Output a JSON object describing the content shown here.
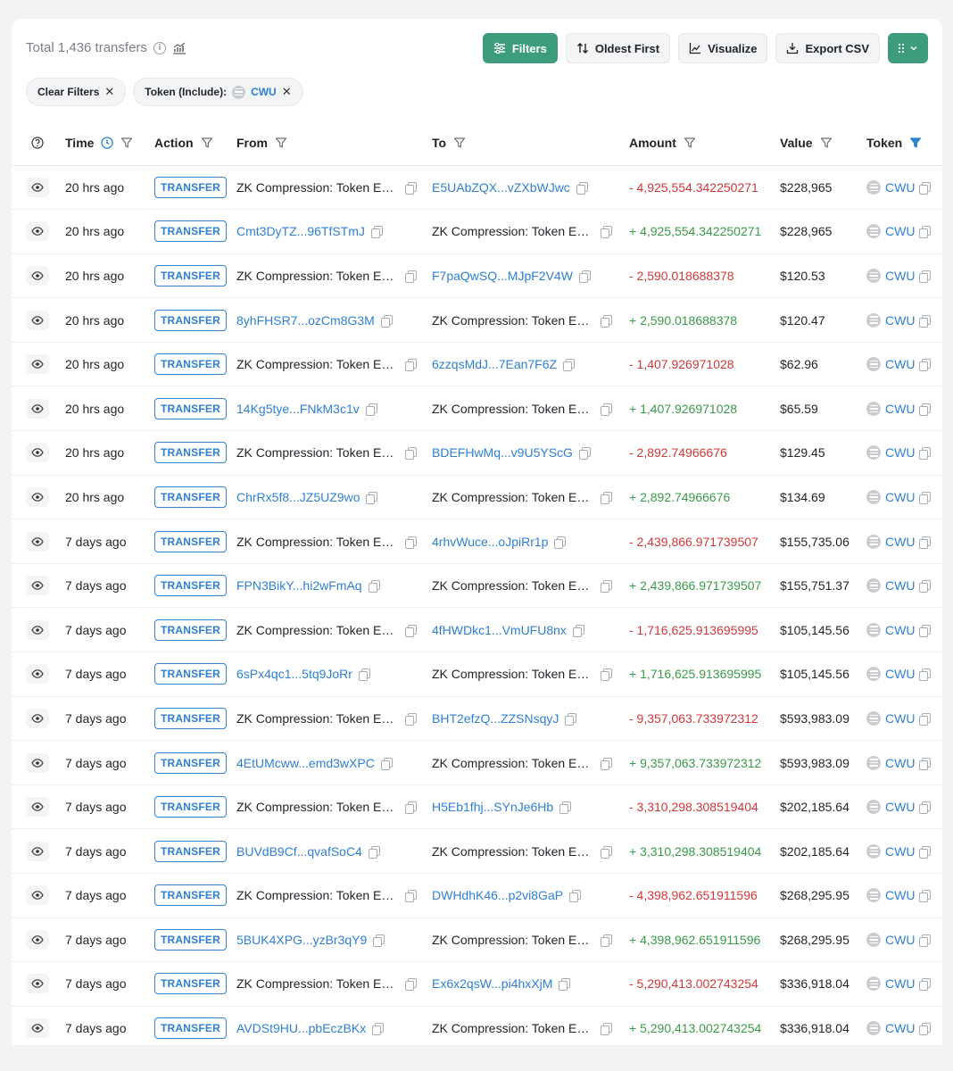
{
  "header": {
    "total": "Total 1,436 transfers",
    "filters": "Filters",
    "sort": "Oldest First",
    "visualize": "Visualize",
    "export": "Export CSV"
  },
  "chips": {
    "clear": "Clear Filters",
    "token_label": "Token (Include):",
    "token_value": "CWU"
  },
  "columns": [
    "Time",
    "Action",
    "From",
    "To",
    "Amount",
    "Value",
    "Token"
  ],
  "zk_label": "ZK Compression: Token Escrow",
  "rows": [
    {
      "time": "20 hrs ago",
      "action": "TRANSFER",
      "from": "ZK Compression: Token Escrow",
      "from_link": false,
      "to": "E5UAbZQX...vZXbWJwc",
      "to_link": true,
      "amount": "- 4,925,554.342250271",
      "dir": "neg",
      "value": "$228,965",
      "token": "CWU"
    },
    {
      "time": "20 hrs ago",
      "action": "TRANSFER",
      "from": "Cmt3DyTZ...96TfSTmJ",
      "from_link": true,
      "to": "ZK Compression: Token Escrow",
      "to_link": false,
      "amount": "+ 4,925,554.342250271",
      "dir": "pos",
      "value": "$228,965",
      "token": "CWU"
    },
    {
      "time": "20 hrs ago",
      "action": "TRANSFER",
      "from": "ZK Compression: Token Escrow",
      "from_link": false,
      "to": "F7paQwSQ...MJpF2V4W",
      "to_link": true,
      "amount": "- 2,590.018688378",
      "dir": "neg",
      "value": "$120.53",
      "token": "CWU"
    },
    {
      "time": "20 hrs ago",
      "action": "TRANSFER",
      "from": "8yhFHSR7...ozCm8G3M",
      "from_link": true,
      "to": "ZK Compression: Token Escrow",
      "to_link": false,
      "amount": "+ 2,590.018688378",
      "dir": "pos",
      "value": "$120.47",
      "token": "CWU"
    },
    {
      "time": "20 hrs ago",
      "action": "TRANSFER",
      "from": "ZK Compression: Token Escrow",
      "from_link": false,
      "to": "6zzqsMdJ...7Ean7F6Z",
      "to_link": true,
      "amount": "- 1,407.926971028",
      "dir": "neg",
      "value": "$62.96",
      "token": "CWU"
    },
    {
      "time": "20 hrs ago",
      "action": "TRANSFER",
      "from": "14Kg5tye...FNkM3c1v",
      "from_link": true,
      "to": "ZK Compression: Token Escrow",
      "to_link": false,
      "amount": "+ 1,407.926971028",
      "dir": "pos",
      "value": "$65.59",
      "token": "CWU"
    },
    {
      "time": "20 hrs ago",
      "action": "TRANSFER",
      "from": "ZK Compression: Token Escrow",
      "from_link": false,
      "to": "BDEFHwMq...v9U5YScG",
      "to_link": true,
      "amount": "- 2,892.74966676",
      "dir": "neg",
      "value": "$129.45",
      "token": "CWU"
    },
    {
      "time": "20 hrs ago",
      "action": "TRANSFER",
      "from": "ChrRx5f8...JZ5UZ9wo",
      "from_link": true,
      "to": "ZK Compression: Token Escrow",
      "to_link": false,
      "amount": "+ 2,892.74966676",
      "dir": "pos",
      "value": "$134.69",
      "token": "CWU"
    },
    {
      "time": "7 days ago",
      "action": "TRANSFER",
      "from": "ZK Compression: Token Escrow",
      "from_link": false,
      "to": "4rhvWuce...oJpiRr1p",
      "to_link": true,
      "amount": "- 2,439,866.971739507",
      "dir": "neg",
      "value": "$155,735.06",
      "token": "CWU"
    },
    {
      "time": "7 days ago",
      "action": "TRANSFER",
      "from": "FPN3BikY...hi2wFmAq",
      "from_link": true,
      "to": "ZK Compression: Token Escrow",
      "to_link": false,
      "amount": "+ 2,439,866.971739507",
      "dir": "pos",
      "value": "$155,751.37",
      "token": "CWU"
    },
    {
      "time": "7 days ago",
      "action": "TRANSFER",
      "from": "ZK Compression: Token Escrow",
      "from_link": false,
      "to": "4fHWDkc1...VmUFU8nx",
      "to_link": true,
      "amount": "- 1,716,625.913695995",
      "dir": "neg",
      "value": "$105,145.56",
      "token": "CWU"
    },
    {
      "time": "7 days ago",
      "action": "TRANSFER",
      "from": "6sPx4qc1...5tq9JoRr",
      "from_link": true,
      "to": "ZK Compression: Token Escrow",
      "to_link": false,
      "amount": "+ 1,716,625.913695995",
      "dir": "pos",
      "value": "$105,145.56",
      "token": "CWU"
    },
    {
      "time": "7 days ago",
      "action": "TRANSFER",
      "from": "ZK Compression: Token Escrow",
      "from_link": false,
      "to": "BHT2efzQ...ZZSNsqyJ",
      "to_link": true,
      "amount": "- 9,357,063.733972312",
      "dir": "neg",
      "value": "$593,983.09",
      "token": "CWU"
    },
    {
      "time": "7 days ago",
      "action": "TRANSFER",
      "from": "4EtUMcww...emd3wXPC",
      "from_link": true,
      "to": "ZK Compression: Token Escrow",
      "to_link": false,
      "amount": "+ 9,357,063.733972312",
      "dir": "pos",
      "value": "$593,983.09",
      "token": "CWU"
    },
    {
      "time": "7 days ago",
      "action": "TRANSFER",
      "from": "ZK Compression: Token Escrow",
      "from_link": false,
      "to": "H5Eb1fhj...SYnJe6Hb",
      "to_link": true,
      "amount": "- 3,310,298.308519404",
      "dir": "neg",
      "value": "$202,185.64",
      "token": "CWU"
    },
    {
      "time": "7 days ago",
      "action": "TRANSFER",
      "from": "BUVdB9Cf...qvafSoC4",
      "from_link": true,
      "to": "ZK Compression: Token Escrow",
      "to_link": false,
      "amount": "+ 3,310,298.308519404",
      "dir": "pos",
      "value": "$202,185.64",
      "token": "CWU"
    },
    {
      "time": "7 days ago",
      "action": "TRANSFER",
      "from": "ZK Compression: Token Escrow",
      "from_link": false,
      "to": "DWHdhK46...p2vi8GaP",
      "to_link": true,
      "amount": "- 4,398,962.651911596",
      "dir": "neg",
      "value": "$268,295.95",
      "token": "CWU"
    },
    {
      "time": "7 days ago",
      "action": "TRANSFER",
      "from": "5BUK4XPG...yzBr3qY9",
      "from_link": true,
      "to": "ZK Compression: Token Escrow",
      "to_link": false,
      "amount": "+ 4,398,962.651911596",
      "dir": "pos",
      "value": "$268,295.95",
      "token": "CWU"
    },
    {
      "time": "7 days ago",
      "action": "TRANSFER",
      "from": "ZK Compression: Token Escrow",
      "from_link": false,
      "to": "Ex6x2qsW...pi4hxXjM",
      "to_link": true,
      "amount": "- 5,290,413.002743254",
      "dir": "neg",
      "value": "$336,918.04",
      "token": "CWU"
    },
    {
      "time": "7 days ago",
      "action": "TRANSFER",
      "from": "AVDSt9HU...pbEczBKx",
      "from_link": true,
      "to": "ZK Compression: Token Escrow",
      "to_link": false,
      "amount": "+ 5,290,413.002743254",
      "dir": "pos",
      "value": "$336,918.04",
      "token": "CWU"
    }
  ],
  "colors": {
    "accent_green": "#3d9c7b",
    "link_blue": "#2f80d1",
    "negative_red": "#d0383a",
    "positive_green": "#3a9a4a"
  },
  "icons": {
    "info": "info-icon",
    "chart": "chart-icon",
    "filters": "sliders-icon",
    "sort": "sort-arrows-icon",
    "visualize": "bar-chart-icon",
    "export": "download-icon",
    "menu": "grid-dots-icon",
    "close": "close-icon",
    "help": "question-circle-icon",
    "clock": "clock-icon",
    "filter": "filter-funnel-icon",
    "eye": "eye-icon",
    "copy": "copy-icon",
    "token": "token-coin-icon"
  }
}
